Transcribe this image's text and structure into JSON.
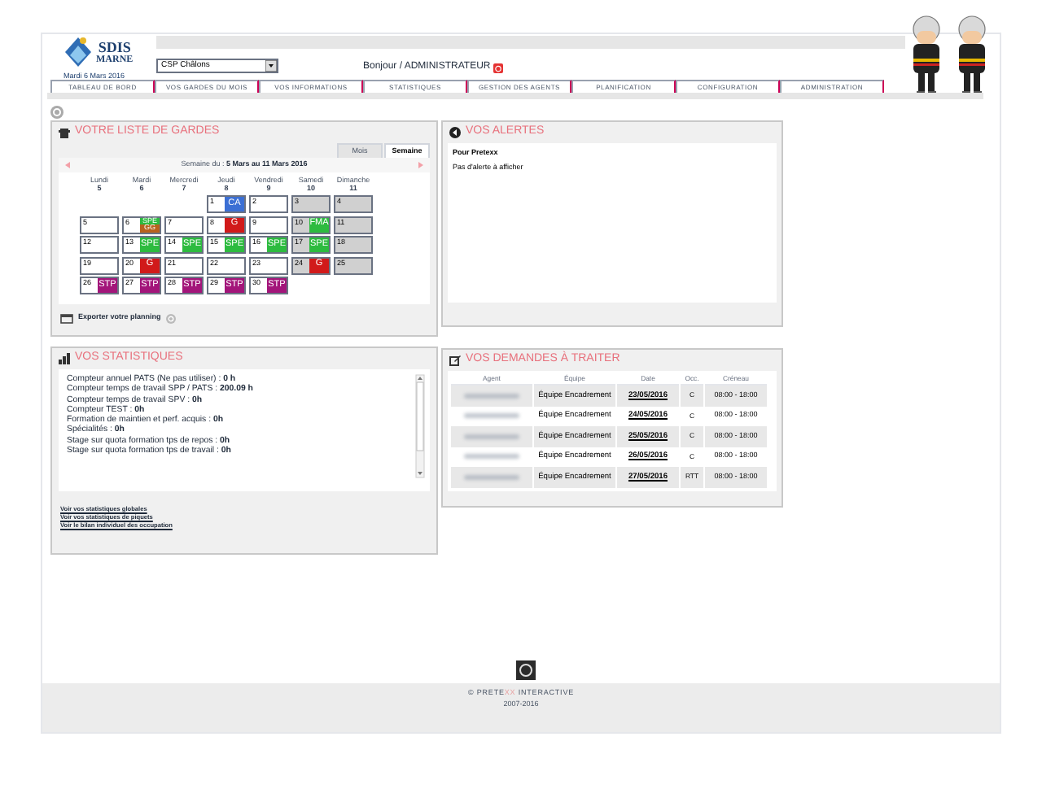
{
  "header": {
    "logo_title": "SDIS",
    "logo_subtitle": "MARNE",
    "date": "Mardi 6 Mars 2016",
    "center_select": {
      "value": "CSP Châlons"
    },
    "greeting": "Bonjour / ADMINISTRATEUR"
  },
  "nav": [
    {
      "label": "TABLEAU DE BORD"
    },
    {
      "label": "VOS GARDES DU MOIS"
    },
    {
      "label": "VOS INFORMATIONS"
    },
    {
      "label": "STATISTIQUES"
    },
    {
      "label": "GESTION DES AGENTS"
    },
    {
      "label": "PLANIFICATION"
    },
    {
      "label": "CONFIGURATION"
    },
    {
      "label": "ADMINISTRATION"
    }
  ],
  "gardes": {
    "title": "VOTRE LISTE DE GARDES",
    "view_tabs": [
      {
        "label": "Mois",
        "selected": false
      },
      {
        "label": "Semaine",
        "selected": true
      }
    ],
    "week_label": "Semaine du :",
    "week_range": "5 Mars au 11 Mars 2016",
    "days": [
      {
        "name": "Lundi",
        "number": "5"
      },
      {
        "name": "Mardi",
        "number": "6"
      },
      {
        "name": "Mercredi",
        "number": "7"
      },
      {
        "name": "Jeudi",
        "number": "8"
      },
      {
        "name": "Vendredi",
        "number": "9"
      },
      {
        "name": "Samedi",
        "number": "10"
      },
      {
        "name": "Dimanche",
        "number": "11"
      }
    ],
    "weeks": [
      [
        {
          "kind": "blank"
        },
        {
          "kind": "blank"
        },
        {
          "kind": "blank"
        },
        {
          "kind": "day",
          "day": "1",
          "codes": [
            {
              "code": "CA",
              "color": "#3b6fd4"
            }
          ]
        },
        {
          "kind": "day",
          "day": "2"
        },
        {
          "kind": "day",
          "day": "3"
        },
        {
          "kind": "day",
          "day": "4"
        }
      ],
      [
        {
          "kind": "day",
          "day": "5"
        },
        {
          "kind": "day",
          "day": "6",
          "codes": [
            {
              "code": "SPE",
              "color": "#2dbb3f"
            },
            {
              "code": "GG",
              "color": "#b8621e"
            }
          ]
        },
        {
          "kind": "day",
          "day": "7"
        },
        {
          "kind": "day",
          "day": "8",
          "codes": [
            {
              "code": "G",
              "color": "#d11a1a"
            }
          ]
        },
        {
          "kind": "day",
          "day": "9"
        },
        {
          "kind": "day",
          "day": "10",
          "codes": [
            {
              "code": "FMA",
              "color": "#2dbb3f"
            }
          ]
        },
        {
          "kind": "day",
          "day": "11"
        }
      ],
      [
        {
          "kind": "day",
          "day": "12"
        },
        {
          "kind": "day",
          "day": "13",
          "codes": [
            {
              "code": "SPE",
              "color": "#2dbb3f"
            }
          ]
        },
        {
          "kind": "day",
          "day": "14",
          "codes": [
            {
              "code": "SPE",
              "color": "#2dbb3f"
            }
          ]
        },
        {
          "kind": "day",
          "day": "15",
          "codes": [
            {
              "code": "SPE",
              "color": "#2dbb3f"
            }
          ]
        },
        {
          "kind": "day",
          "day": "16",
          "codes": [
            {
              "code": "SPE",
              "color": "#2dbb3f"
            }
          ]
        },
        {
          "kind": "day",
          "day": "17",
          "codes": [
            {
              "code": "SPE",
              "color": "#2dbb3f"
            }
          ]
        },
        {
          "kind": "day",
          "day": "18"
        }
      ],
      [
        {
          "kind": "day",
          "day": "19"
        },
        {
          "kind": "day",
          "day": "20",
          "codes": [
            {
              "code": "G",
              "color": "#d11a1a"
            }
          ]
        },
        {
          "kind": "day",
          "day": "21"
        },
        {
          "kind": "day",
          "day": "22"
        },
        {
          "kind": "day",
          "day": "23"
        },
        {
          "kind": "day",
          "day": "24",
          "codes": [
            {
              "code": "G",
              "color": "#d11a1a"
            }
          ]
        },
        {
          "kind": "day",
          "day": "25"
        }
      ],
      [
        {
          "kind": "day",
          "day": "26",
          "codes": [
            {
              "code": "STP",
              "color": "#a3157a"
            }
          ]
        },
        {
          "kind": "day",
          "day": "27",
          "codes": [
            {
              "code": "STP",
              "color": "#a3157a"
            }
          ]
        },
        {
          "kind": "day",
          "day": "28",
          "codes": [
            {
              "code": "STP",
              "color": "#a3157a"
            }
          ]
        },
        {
          "kind": "day",
          "day": "29",
          "codes": [
            {
              "code": "STP",
              "color": "#a3157a"
            }
          ]
        },
        {
          "kind": "day",
          "day": "30",
          "codes": [
            {
              "code": "STP",
              "color": "#a3157a"
            }
          ]
        }
      ]
    ],
    "export_label": "Exporter votre planning"
  },
  "alerts": {
    "title": "VOS ALERTES",
    "heading": "Pour Pretexx",
    "message": "Pas d'alerte à afficher"
  },
  "stats": {
    "title": "VOS STATISTIQUES",
    "lines": [
      "Compteur annuel PATS (Ne pas utiliser) : **0 h**",
      "Compteur temps de travail SPP / PATS : **200.09 h**",
      "Compteur temps de travail SPV : **0h**",
      "Compteur TEST : **0h**",
      "Formation de maintien et perf. acquis : **0h**",
      "Spécialités : **0h**",
      "Stage sur quota formation tps de repos : **0h**",
      "Stage sur quota formation tps de travail : **0h**"
    ],
    "links": [
      "Voir vos statistiques globales",
      "Voir vos statistiques de piquets",
      "Voir le bilan individuel des occupation"
    ]
  },
  "requests": {
    "title": "VOS DEMANDES À TRAITER",
    "columns": [
      "Agent",
      "Équipe",
      "Date",
      "Occ.",
      "Créneau"
    ],
    "rows": [
      {
        "team": "Équipe Encadrement",
        "date": "23/05/2016",
        "occ": "C",
        "slot": "08:00 - 18:00"
      },
      {
        "team": "Équipe Encadrement",
        "date": "24/05/2016",
        "occ": "C",
        "slot": "08:00 - 18:00"
      },
      {
        "team": "Équipe Encadrement",
        "date": "25/05/2016",
        "occ": "C",
        "slot": "08:00 - 18:00"
      },
      {
        "team": "Équipe Encadrement",
        "date": "26/05/2016",
        "occ": "C",
        "slot": "08:00 - 18:00"
      },
      {
        "team": "Équipe Encadrement",
        "date": "27/05/2016",
        "occ": "RTT",
        "slot": "08:00 - 18:00"
      }
    ]
  },
  "footer": {
    "brand_start": "© PRETE",
    "brand_highlight": "XX",
    "brand_end": " INTERACTIVE",
    "years": "2007-2016"
  }
}
